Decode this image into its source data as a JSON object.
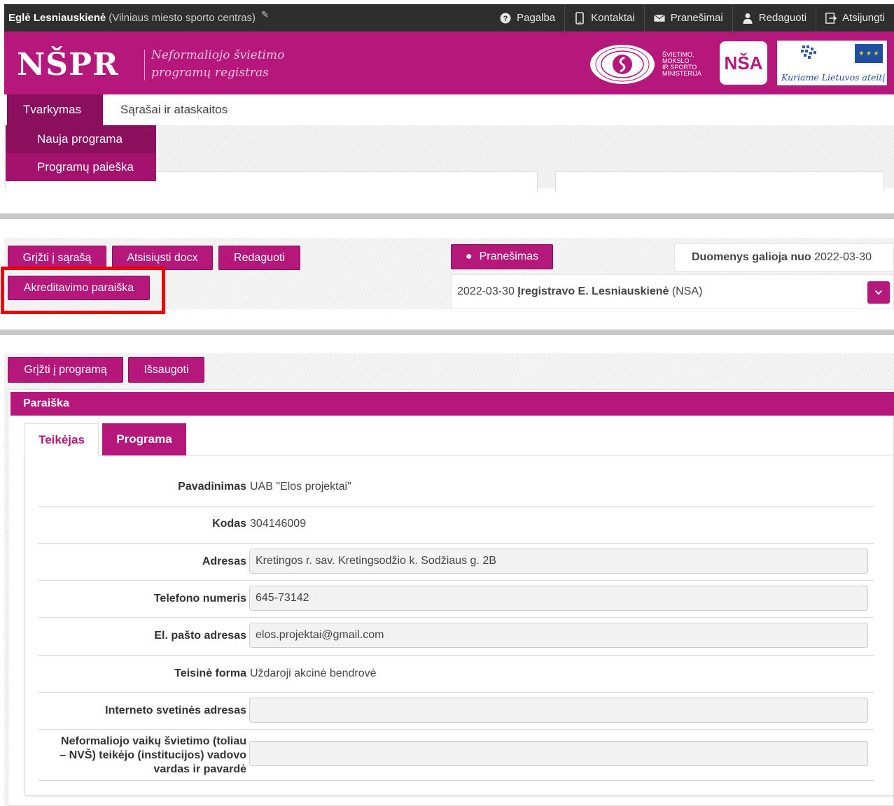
{
  "topbar": {
    "user_name": "Eglė Lesniauskienė",
    "user_org": "(Vilniaus miesto sporto centras)",
    "nav": [
      {
        "label": "Pagalba",
        "icon": "help-icon"
      },
      {
        "label": "Kontaktai",
        "icon": "phone-icon"
      },
      {
        "label": "Pranešimai",
        "icon": "envelope-icon"
      },
      {
        "label": "Redaguoti",
        "icon": "user-icon"
      },
      {
        "label": "Atsijungti",
        "icon": "logout-icon"
      }
    ]
  },
  "header": {
    "logo": "NŠPR",
    "subtitle_line1": "Neformaliojo švietimo",
    "subtitle_line2": "programų registras",
    "ministry": [
      "ŠVIETIMO,",
      "MOKSLO",
      "IR SPORTO",
      "MINISTERIJA"
    ],
    "nsa": "NŠA",
    "eu_slogan": "Kuriame Lietuvos ateitį"
  },
  "menu": {
    "tvarkymas": "Tvarkymas",
    "sarasai": "Sąrašai ir ataskaitos",
    "sub_items": [
      "Nauja programa",
      "Programų paieška"
    ]
  },
  "program_view": {
    "buttons": {
      "back_to_list": "Grįžti į sąrašą",
      "download_docx": "Atsisiųsti docx",
      "edit": "Redaguoti",
      "accreditation": "Akreditavimo paraiška",
      "notice": "Pranešimas"
    },
    "valid_label": "Duomenys galioja nuo",
    "valid_date": "2022-03-30",
    "reg_date": "2022-03-30",
    "reg_text": "Įregistravo E. Lesniauskienė",
    "reg_org": "(NSA)"
  },
  "application": {
    "buttons": {
      "back_to_program": "Grįžti į programą",
      "save": "Išsaugoti"
    },
    "panel_title": "Paraiška",
    "tabs": [
      "Teikėjas",
      "Programa"
    ],
    "fields": {
      "name_label": "Pavadinimas",
      "name_value": "UAB \"Elos projektai\"",
      "code_label": "Kodas",
      "code_value": "304146009",
      "address_label": "Adresas",
      "address_value": "Kretingos r. sav. Kretingsodžio k. Sodžiaus g. 2B",
      "phone_label": "Telefono numeris",
      "phone_value": "645-73142",
      "email_label": "El. pašto adresas",
      "email_value": "elos.projektai@gmail.com",
      "legal_label": "Teisinė forma",
      "legal_value": "Uždaroji akcinė bendrovė",
      "website_label": "Interneto svetinės adresas",
      "website_value": "",
      "head_label_1": "Neformaliojo vaikų švietimo (toliau",
      "head_label_2": "– NVŠ) teikėjo (institucijos) vadovo",
      "head_label_3": "vardas ir pavardė",
      "head_value": ""
    }
  }
}
